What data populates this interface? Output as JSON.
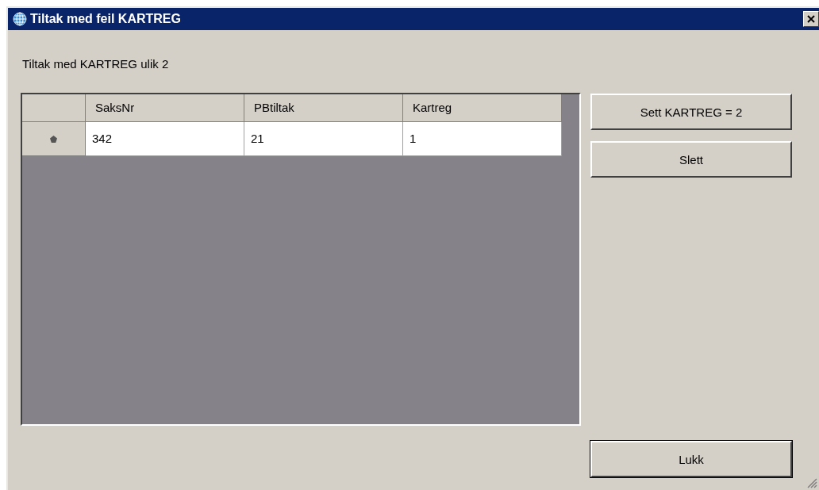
{
  "window": {
    "title": "Tiltak med feil KARTREG"
  },
  "caption": "Tiltak med KARTREG ulik 2",
  "table": {
    "columns": [
      "SaksNr",
      "PBtiltak",
      "Kartreg"
    ],
    "rows": [
      {
        "cells": [
          "342",
          "21",
          "1"
        ]
      }
    ]
  },
  "buttons": [
    "Sett KARTREG = 2",
    "Slett"
  ],
  "close_button": "Lukk"
}
